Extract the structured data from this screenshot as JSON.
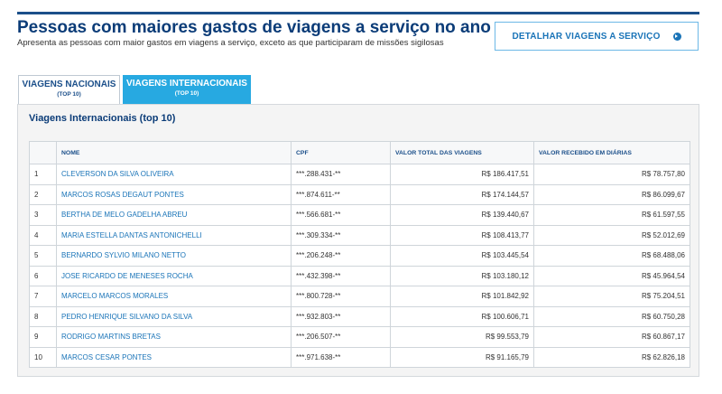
{
  "header": {
    "title": "Pessoas com maiores gastos de viagens a serviço no ano",
    "subtitle": "Apresenta as pessoas com maior gastos em viagens a serviço, exceto as que participaram de missões sigilosas",
    "detail_button": "DETALHAR VIAGENS A SERVIÇO",
    "detail_icon": "arrow-circle-right"
  },
  "tabs": [
    {
      "label": "VIAGENS NACIONAIS",
      "sub": "(TOP 10)",
      "active": false
    },
    {
      "label": "VIAGENS INTERNACIONAIS",
      "sub": "(TOP 10)",
      "active": true
    }
  ],
  "panel": {
    "title": "Viagens Internacionais (top 10)"
  },
  "table": {
    "columns": [
      "",
      "NOME",
      "CPF",
      "VALOR TOTAL DAS VIAGENS",
      "VALOR RECEBIDO EM DIÁRIAS"
    ],
    "rows": [
      {
        "rank": "1",
        "name": "CLEVERSON DA SILVA OLIVEIRA",
        "cpf": "***.288.431-**",
        "total": "R$ 186.417,51",
        "diarias": "R$ 78.757,80"
      },
      {
        "rank": "2",
        "name": "MARCOS ROSAS DEGAUT PONTES",
        "cpf": "***.874.611-**",
        "total": "R$ 174.144,57",
        "diarias": "R$ 86.099,67"
      },
      {
        "rank": "3",
        "name": "BERTHA DE MELO GADELHA ABREU",
        "cpf": "***.566.681-**",
        "total": "R$ 139.440,67",
        "diarias": "R$ 61.597,55"
      },
      {
        "rank": "4",
        "name": "MARIA ESTELLA DANTAS ANTONICHELLI",
        "cpf": "***.309.334-**",
        "total": "R$ 108.413,77",
        "diarias": "R$ 52.012,69"
      },
      {
        "rank": "5",
        "name": "BERNARDO SYLVIO MILANO NETTO",
        "cpf": "***.206.248-**",
        "total": "R$ 103.445,54",
        "diarias": "R$ 68.488,06"
      },
      {
        "rank": "6",
        "name": "JOSE RICARDO DE MENESES ROCHA",
        "cpf": "***.432.398-**",
        "total": "R$ 103.180,12",
        "diarias": "R$ 45.964,54"
      },
      {
        "rank": "7",
        "name": "MARCELO MARCOS MORALES",
        "cpf": "***.800.728-**",
        "total": "R$ 101.842,92",
        "diarias": "R$ 75.204,51"
      },
      {
        "rank": "8",
        "name": "PEDRO HENRIQUE SILVANO DA SILVA",
        "cpf": "***.932.803-**",
        "total": "R$ 100.606,71",
        "diarias": "R$ 60.750,28"
      },
      {
        "rank": "9",
        "name": "RODRIGO MARTINS BRETAS",
        "cpf": "***.206.507-**",
        "total": "R$ 99.553,79",
        "diarias": "R$ 60.867,17"
      },
      {
        "rank": "10",
        "name": "MARCOS CESAR PONTES",
        "cpf": "***.971.638-**",
        "total": "R$ 91.165,79",
        "diarias": "R$ 62.826,18"
      }
    ]
  },
  "colors": {
    "title": "#0b3c78",
    "accent": "#27a9e1",
    "link": "#1a74b8",
    "rule": "#1b4f8a"
  }
}
